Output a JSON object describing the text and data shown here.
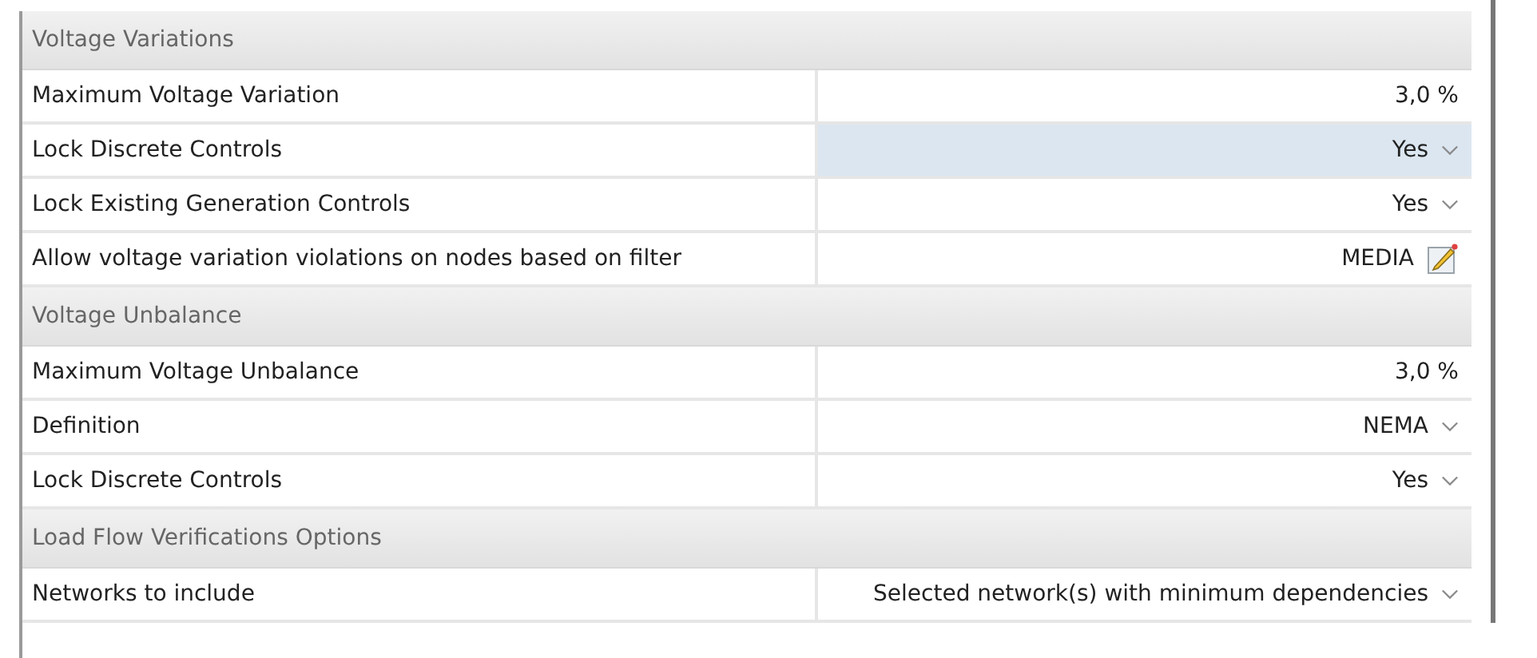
{
  "sections": [
    {
      "title": "Voltage Variations",
      "rows": [
        {
          "label": "Maximum Voltage Variation",
          "kind": "number",
          "value": "3,0 %",
          "selected": false
        },
        {
          "label": "Lock Discrete Controls",
          "kind": "dropdown",
          "value": "Yes",
          "selected": true
        },
        {
          "label": "Lock Existing Generation Controls",
          "kind": "dropdown",
          "value": "Yes",
          "selected": false
        },
        {
          "label": "Allow voltage variation violations on nodes based on filter",
          "kind": "filter",
          "value": "MEDIA",
          "selected": false
        }
      ]
    },
    {
      "title": "Voltage Unbalance",
      "rows": [
        {
          "label": "Maximum Voltage Unbalance",
          "kind": "number",
          "value": "3,0 %",
          "selected": false
        },
        {
          "label": "Definition",
          "kind": "dropdown",
          "value": "NEMA",
          "selected": false
        },
        {
          "label": "Lock Discrete Controls",
          "kind": "dropdown",
          "value": "Yes",
          "selected": false
        }
      ]
    },
    {
      "title": "Load Flow Verifications Options",
      "rows": [
        {
          "label": "Networks to include",
          "kind": "dropdown",
          "value": "Selected network(s) with minimum dependencies",
          "selected": false
        }
      ]
    }
  ]
}
